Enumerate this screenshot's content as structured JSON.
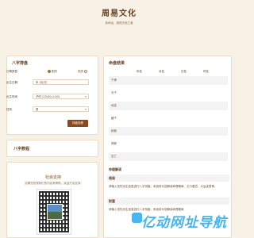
{
  "header": {
    "title": "周易文化",
    "subtitle": "探命运，感悟天地之道"
  },
  "form": {
    "title": "八字排盘",
    "name_label": "日期类型",
    "radio_solar": "阳历",
    "radio_lunar": "农历",
    "birth_date_label": "出生日期",
    "birth_date_value": "年 /月/日",
    "birth_time_label": "出生时间",
    "birth_time_value": "子时 (23:00-1:00)",
    "gender_label": "性别",
    "gender_value": "男",
    "submit_label": "排盘查看"
  },
  "liuzi": {
    "title": "八字教程"
  },
  "support": {
    "title": "社会支持",
    "text": "如果您觉得我们的内容有帮助，欢迎打赏支持!"
  },
  "result": {
    "title": "命盘结果",
    "columns": [
      "年柱",
      "月柱",
      "日柱",
      "时柱"
    ],
    "rows": [
      "干神",
      "天干",
      "地支",
      "藏干",
      "纳音",
      "神煞",
      "空亡"
    ],
    "analysis_title": "命理解读",
    "sections": [
      {
        "title": "格局",
        "body": "请输入您的出生信息进行八字排盘，系统将为您解读命理格局、五行喜忌、大运走势等。"
      },
      {
        "title": "财富",
        "body": "请输入您的出生信息进行八字排盘，系统将为您解读命理格局"
      }
    ]
  },
  "watermark": {
    "text": "亿动网址导航"
  }
}
